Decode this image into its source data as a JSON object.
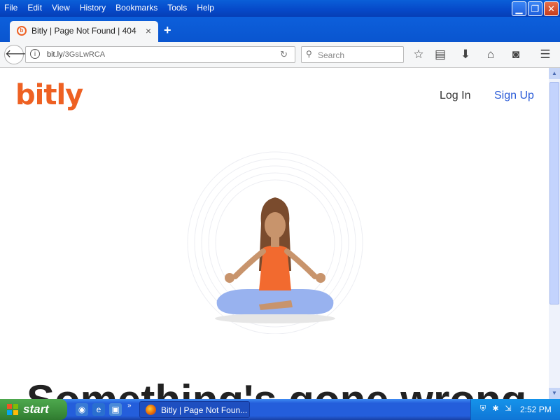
{
  "browser": {
    "menus": [
      "File",
      "Edit",
      "View",
      "History",
      "Bookmarks",
      "Tools",
      "Help"
    ],
    "tab_title": "Bitly | Page Not Found | 404",
    "tab_close": "×",
    "new_tab": "+",
    "url_host": "bit.ly",
    "url_path": "/3GsLwRCA",
    "search_placeholder": "Search"
  },
  "page": {
    "logo": "bitly",
    "login": "Log In",
    "signup": "Sign Up",
    "headline": "Something's gone wrong"
  },
  "taskbar": {
    "start": "start",
    "task_title": "Bitly | Page Not Foun...",
    "clock": "2:52 PM"
  },
  "colors": {
    "brand": "#ee6123",
    "link": "#2a5bd7",
    "xp_blue": "#245edb"
  }
}
